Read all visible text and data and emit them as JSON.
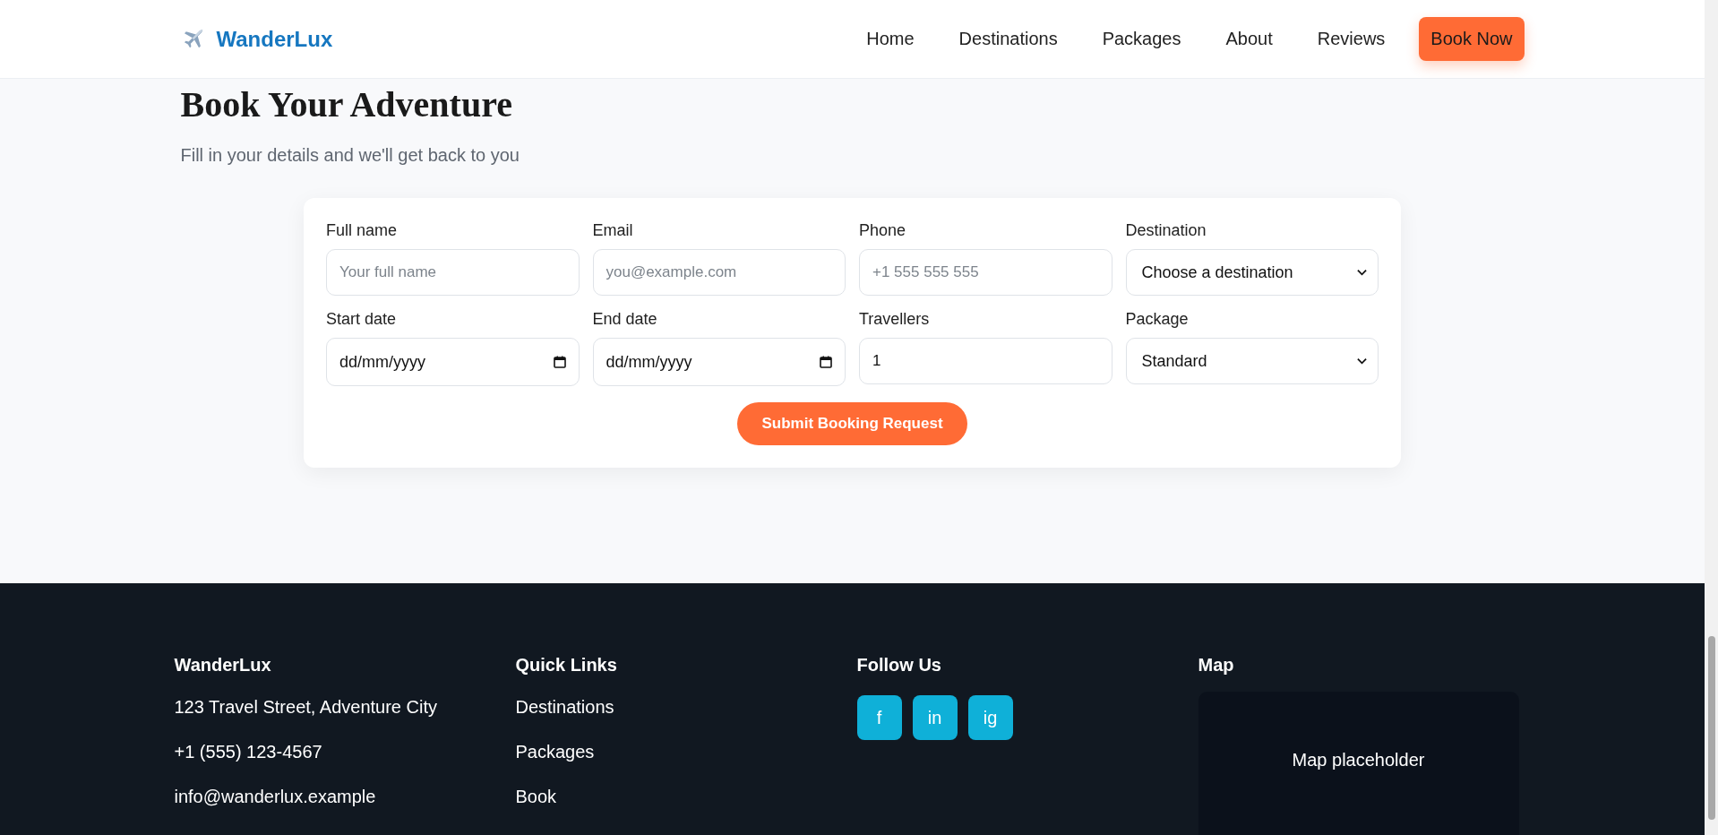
{
  "header": {
    "brand": "WanderLux",
    "nav": [
      {
        "label": "Home"
      },
      {
        "label": "Destinations"
      },
      {
        "label": "Packages"
      },
      {
        "label": "About"
      },
      {
        "label": "Reviews"
      }
    ],
    "cta": "Book Now"
  },
  "booking": {
    "title": "Book Your Adventure",
    "subtitle": "Fill in your details and we'll get back to you",
    "fields": [
      {
        "label": "Full name",
        "kind": "text",
        "placeholder": "Your full name"
      },
      {
        "label": "Email",
        "kind": "text",
        "placeholder": "you@example.com"
      },
      {
        "label": "Phone",
        "kind": "text",
        "placeholder": "+1 555 555 555"
      },
      {
        "label": "Destination",
        "kind": "select",
        "value": "Choose a destination"
      },
      {
        "label": "Start date",
        "kind": "date",
        "value": "dd/mm/yyyy"
      },
      {
        "label": "End date",
        "kind": "date",
        "value": "dd/mm/yyyy"
      },
      {
        "label": "Travellers",
        "kind": "text",
        "value": "1"
      },
      {
        "label": "Package",
        "kind": "select",
        "value": "Standard"
      }
    ],
    "submit": "Submit Booking Request"
  },
  "footer": {
    "columns": [
      {
        "heading": "WanderLux",
        "kind": "text",
        "items": [
          "123 Travel Street, Adventure City",
          "+1 (555) 123-4567",
          "info@wanderlux.example"
        ]
      },
      {
        "heading": "Quick Links",
        "kind": "links",
        "items": [
          "Destinations",
          "Packages",
          "Book"
        ]
      },
      {
        "heading": "Follow Us",
        "kind": "social",
        "items": [
          "f",
          "in",
          "ig"
        ]
      },
      {
        "heading": "Map",
        "kind": "map",
        "items": [
          "Map placeholder"
        ]
      }
    ]
  }
}
